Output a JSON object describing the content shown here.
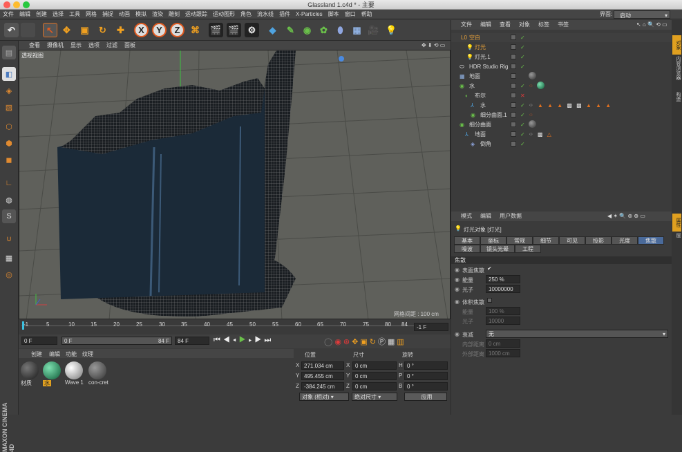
{
  "window_title": "Glassland 1.c4d * - 主要",
  "menu": [
    "文件",
    "编辑",
    "创建",
    "选择",
    "工具",
    "网格",
    "捕捉",
    "动画",
    "模拟",
    "渲染",
    "雕刻",
    "运动跟踪",
    "运动图形",
    "角色",
    "流水线",
    "插件",
    "X-Particles",
    "脚本",
    "窗口",
    "帮助"
  ],
  "layout_label": "界面:",
  "layout_value": "启动",
  "toolbar": {
    "x": "X",
    "y": "Y",
    "z": "Z"
  },
  "viewport": {
    "menu": [
      "查看",
      "摄像机",
      "显示",
      "选项",
      "过滤",
      "面板"
    ],
    "label": "透视视图",
    "grid_info": "网格间距 : 100 cm"
  },
  "timeline": {
    "ticks": [
      "-1",
      "5",
      "10",
      "15",
      "20",
      "25",
      "30",
      "35",
      "40",
      "45",
      "50",
      "55",
      "60",
      "65",
      "70",
      "75",
      "80",
      "84"
    ],
    "current_frame": "-1 F"
  },
  "transport": {
    "start": "0 F",
    "preview_start": "0 F",
    "preview_end": "84 F",
    "end": "84 F"
  },
  "materials": {
    "menu": [
      "创建",
      "编辑",
      "功能",
      "纹理"
    ],
    "items": [
      {
        "name": "材质",
        "color": "#2a2a2a"
      },
      {
        "name": "水",
        "color": "#1c8a5a"
      },
      {
        "name": "Wave 1",
        "color": "#cfcfcf"
      },
      {
        "name": "con-cret",
        "color": "#555555"
      }
    ]
  },
  "coords": {
    "headers": [
      "位置",
      "尺寸",
      "旋转"
    ],
    "rows": [
      {
        "axis": "X",
        "pos": "271.034 cm",
        "size_axis": "X",
        "size": "0 cm",
        "rot_axis": "H",
        "rot": "0 °"
      },
      {
        "axis": "Y",
        "pos": "495.455 cm",
        "size_axis": "Y",
        "size": "0 cm",
        "rot_axis": "P",
        "rot": "0 °"
      },
      {
        "axis": "Z",
        "pos": "-384.245 cm",
        "size_axis": "Z",
        "size": "0 cm",
        "rot_axis": "B",
        "rot": "0 °"
      }
    ],
    "mode": "对象 (相对)",
    "size_mode": "绝对尺寸",
    "apply": "应用"
  },
  "objects": {
    "menu": [
      "文件",
      "编辑",
      "查看",
      "对象",
      "标签",
      "书签"
    ],
    "rows": [
      {
        "name": "空白",
        "indent": 0,
        "color": "#e8a23a"
      },
      {
        "name": "灯光",
        "indent": 1,
        "color": "#e8a23a"
      },
      {
        "name": "灯光.1",
        "indent": 1,
        "color": "#d8d8d8"
      },
      {
        "name": "HDR Studio Rig",
        "indent": 0,
        "color": "#d8d8d8"
      },
      {
        "name": "地面",
        "indent": 0,
        "color": "#d8d8d8"
      },
      {
        "name": "水",
        "indent": 0,
        "color": "#d8d8d8"
      },
      {
        "name": "布尔",
        "indent": 1,
        "color": "#d8d8d8"
      },
      {
        "name": "水",
        "indent": 2,
        "color": "#d8d8d8"
      },
      {
        "name": "细分曲面.1",
        "indent": 2,
        "color": "#d8d8d8"
      },
      {
        "name": "细分曲面",
        "indent": 0,
        "color": "#d8d8d8"
      },
      {
        "name": "地面",
        "indent": 1,
        "color": "#d8d8d8"
      },
      {
        "name": "倒角",
        "indent": 2,
        "color": "#d8d8d8"
      }
    ]
  },
  "attributes": {
    "menu": [
      "模式",
      "编辑",
      "用户数据"
    ],
    "object_title": "灯光对象 [灯光]",
    "tabs_row1": [
      "基本",
      "坐标",
      "常规",
      "细节",
      "可见",
      "投影",
      "光度",
      "焦散"
    ],
    "tabs_row2": [
      "噪波",
      "镜头光晕",
      "工程"
    ],
    "section": "焦散",
    "fields": {
      "surface_caustics": "表面焦散",
      "energy_label": "能量",
      "energy": "250 %",
      "photons_label": "光子",
      "photons": "10000000",
      "volume_caustics": "体积焦散",
      "v_energy_label": "能量",
      "v_energy": "100 %",
      "v_photons_label": "光子",
      "v_photons": "10000",
      "falloff_label": "衰减",
      "falloff": "无",
      "inner_label": "内部距离",
      "inner": "0 cm",
      "outer_label": "外部距离",
      "outer": "1000 cm"
    }
  },
  "side_tabs": [
    "对象",
    "内容浏览器",
    "构造",
    "属性",
    "层"
  ],
  "brand": "MAXON CINEMA 4D"
}
